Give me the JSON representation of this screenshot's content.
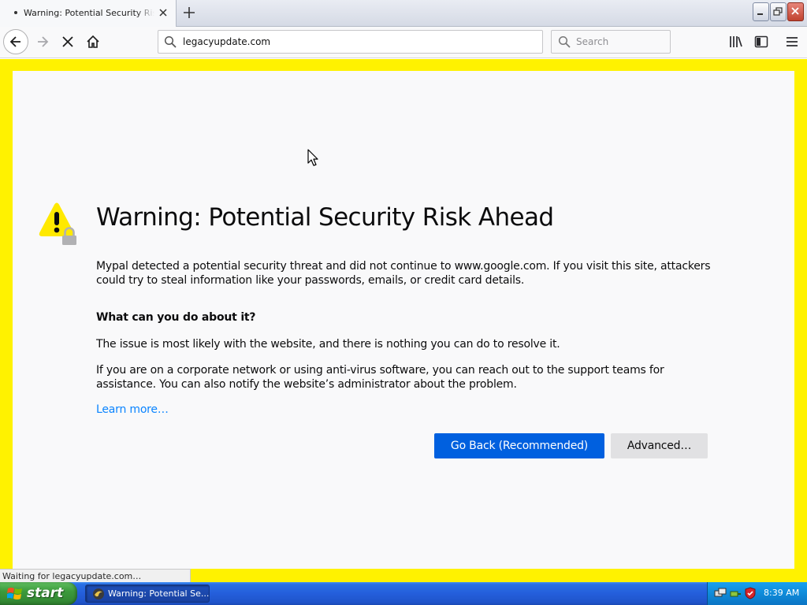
{
  "tab": {
    "title": "Warning: Potential Security Risk Ahead"
  },
  "nav": {
    "url": "legacyupdate.com",
    "search_placeholder": "Search"
  },
  "page": {
    "title": "Warning: Potential Security Risk Ahead",
    "intro": "Mypal detected a potential security threat and did not continue to www.google.com. If you visit this site, attackers could try to steal information like your passwords, emails, or credit card details.",
    "subheading": "What can you do about it?",
    "para1": "The issue is most likely with the website, and there is nothing you can do to resolve it.",
    "para2": "If you are on a corporate network or using anti-virus software, you can reach out to the support teams for assistance. You can also notify the website’s administrator about the problem.",
    "learn_more": "Learn more…",
    "go_back_label": "Go Back (Recommended)",
    "advanced_label": "Advanced…"
  },
  "status": {
    "text": "Waiting for legacyupdate.com…"
  },
  "taskbar": {
    "start_label": "start",
    "task_label": "Warning: Potential Se...",
    "clock": "8:39 AM"
  },
  "colors": {
    "frame": "#fff200",
    "primary_button": "#0060df",
    "link": "#0a84ff",
    "warning_icon": "#ffe900"
  }
}
